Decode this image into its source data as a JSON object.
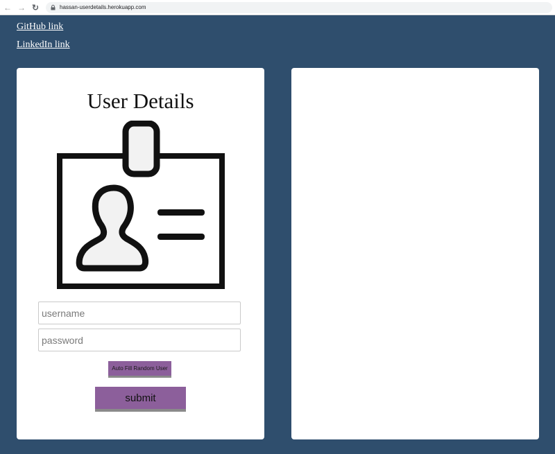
{
  "browser": {
    "url": "hassan-userdetails.herokuapp.com"
  },
  "links": {
    "github": "GitHub link",
    "linkedin": "LinkedIn link"
  },
  "form": {
    "title": "User Details",
    "username_placeholder": "username",
    "password_placeholder": "password",
    "autofill_label": "Auto Fill Random User",
    "submit_label": "submit"
  },
  "colors": {
    "background": "#2f4e6d",
    "card": "#ffffff",
    "button": "#8c5f9b"
  },
  "icons": {
    "badge": "id-badge-icon"
  }
}
